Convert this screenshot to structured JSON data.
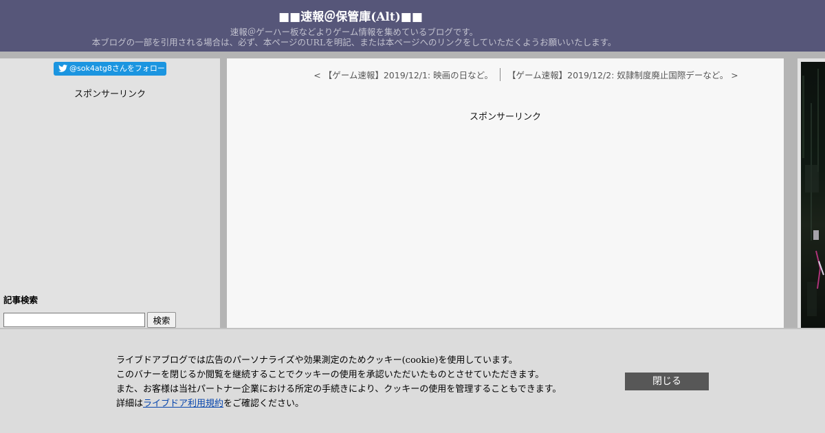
{
  "header": {
    "title": "■■速報＠保管庫(Alt)■■",
    "description_line1": "速報＠ゲーハー板などよりゲーム情報を集めているブログです。",
    "description_line2": "本ブログの一部を引用される場合は、必ず、本ページのURLを明記、または本ページへのリンクをしていただくようお願いいたします。"
  },
  "sidebar": {
    "twitter_follow": "@sok4atg8さんをフォロー",
    "sponsor_label": "スポンサーリンク",
    "search_title": "記事検索",
    "search_value": "",
    "search_button": "検索"
  },
  "main": {
    "prev_post": "< 【ゲーム速報】2019/12/1: 映画の日など。",
    "next_post": "【ゲーム速報】2019/12/2: 奴隷制度廃止国際デーなど。 >",
    "sponsor_label": "スポンサーリンク"
  },
  "cookie_banner": {
    "line1": "ライブドアブログでは広告のパーソナライズや効果測定のためクッキー(cookie)を使用しています。",
    "line2": "このバナーを閉じるか閲覧を継続することでクッキーの使用を承認いただいたものとさせていただきます。",
    "line3": "また、お客様は当社パートナー企業における所定の手続きにより、クッキーの使用を管理することもできます。",
    "line4_prefix": "詳細は",
    "line4_link": "ライブドア利用規約",
    "line4_suffix": "をご確認ください。",
    "close_button": "閉じる"
  },
  "icons": {
    "twitter": "twitter-bird-icon"
  },
  "colors": {
    "header_bg": "#565679",
    "twitter_blue": "#1b95e0",
    "close_button_bg": "#575757"
  }
}
